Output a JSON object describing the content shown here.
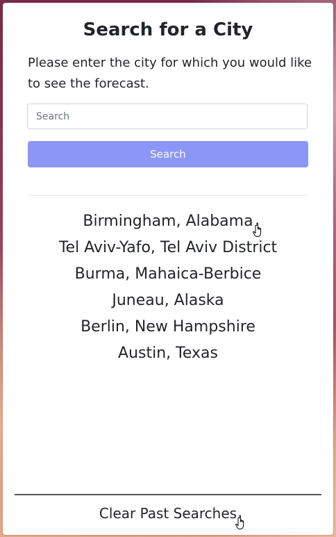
{
  "header": {
    "title": "Search for a City",
    "description": "Please enter the city for which you would like to see the forecast."
  },
  "search": {
    "placeholder": "Search",
    "value": "",
    "button_label": "Search",
    "button_color": "#8c96f7"
  },
  "history": {
    "items": [
      {
        "label": "Birmingham, Alabama"
      },
      {
        "label": "Tel Aviv-Yafo, Tel Aviv District"
      },
      {
        "label": "Burma, Mahaica-Berbice"
      },
      {
        "label": "Juneau, Alaska"
      },
      {
        "label": "Berlin, New Hampshire"
      },
      {
        "label": "Austin, Texas"
      }
    ]
  },
  "footer": {
    "clear_label": "Clear Past Searches"
  },
  "icons": {
    "cursor": "hand-pointer-icon"
  }
}
